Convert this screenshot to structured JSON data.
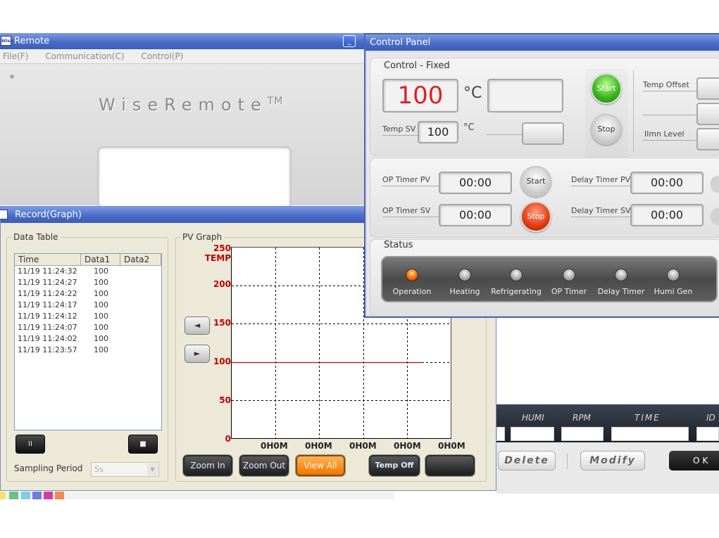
{
  "remote": {
    "title": "Remote",
    "icon_text": "Wise",
    "minimize": "_",
    "menu": [
      "File(F)",
      "Communication(C)",
      "Control(P)"
    ],
    "logo": "WiseRemote",
    "logo_tm": "TM"
  },
  "record": {
    "title": "Record(Graph)",
    "data_table": {
      "label": "Data Table",
      "columns": [
        "Time",
        "Data1",
        "Data2"
      ],
      "rows": [
        {
          "time": "11/19 11:24:32",
          "data1": "100",
          "data2": ""
        },
        {
          "time": "11/19 11:24:27",
          "data1": "100",
          "data2": ""
        },
        {
          "time": "11/19 11:24:22",
          "data1": "100",
          "data2": ""
        },
        {
          "time": "11/19 11:24:17",
          "data1": "100",
          "data2": ""
        },
        {
          "time": "11/19 11:24:12",
          "data1": "100",
          "data2": ""
        },
        {
          "time": "11/19 11:24:07",
          "data1": "100",
          "data2": ""
        },
        {
          "time": "11/19 11:24:02",
          "data1": "100",
          "data2": ""
        },
        {
          "time": "11/19 11:23:57",
          "data1": "100",
          "data2": ""
        }
      ]
    },
    "pause_glyph": "II",
    "stop_glyph": "■",
    "sampling_label": "Sampling Period",
    "sampling_value": "5s",
    "graph": {
      "label": "PV Graph",
      "series_label": "TEMP",
      "y_ticks": [
        "250",
        "200",
        "150",
        "100",
        "50",
        "0"
      ],
      "x_ticks": [
        "0H0M",
        "0H0M",
        "0H0M",
        "0H0M",
        "0H0M"
      ],
      "ylim": [
        0,
        250
      ],
      "pv_value": 100,
      "pv_end_fraction": 0.87,
      "line_color": "#cc0000"
    },
    "nav_left": "◄",
    "nav_right": "►",
    "buttons": {
      "zoom_in": "Zoom In",
      "zoom_out": "Zoom Out",
      "view_all": "View All",
      "temp_off": "Temp Off",
      "blank": ""
    }
  },
  "data_panel": {
    "columns": [
      "HUMI",
      "RPM",
      "TIME",
      "ID"
    ],
    "delete": "Delete",
    "modify": "Modify",
    "ok": "OK"
  },
  "control_panel": {
    "title": "Control Panel",
    "fixed_title": "Control - Fixed",
    "pv_value": "100",
    "unit": "°C",
    "unit_small": "°C",
    "temp_sv_label": "Temp SV",
    "temp_sv_value": "100",
    "start": "Start",
    "stop": "Stop",
    "temp_offset_label": "Temp Offset",
    "ilmn_level_label": "Ilmn Level",
    "op_timer_pv_label": "OP Timer PV",
    "op_timer_pv": "00:00",
    "op_timer_sv_label": "OP Timer SV",
    "op_timer_sv": "00:00",
    "delay_timer_pv_label": "Delay Timer PV",
    "delay_timer_pv": "00:00",
    "delay_timer_sv_label": "Delay Timer SV",
    "delay_timer_sv": "00:00",
    "status_title": "Status",
    "status": [
      {
        "label": "Operation",
        "on": true
      },
      {
        "label": "Heating",
        "on": false
      },
      {
        "label": "Refrigerating",
        "on": false
      },
      {
        "label": "OP Timer",
        "on": false
      },
      {
        "label": "Delay Timer",
        "on": false
      },
      {
        "label": "Humi Gen",
        "on": false
      }
    ],
    "pv_color": "#e02020"
  }
}
